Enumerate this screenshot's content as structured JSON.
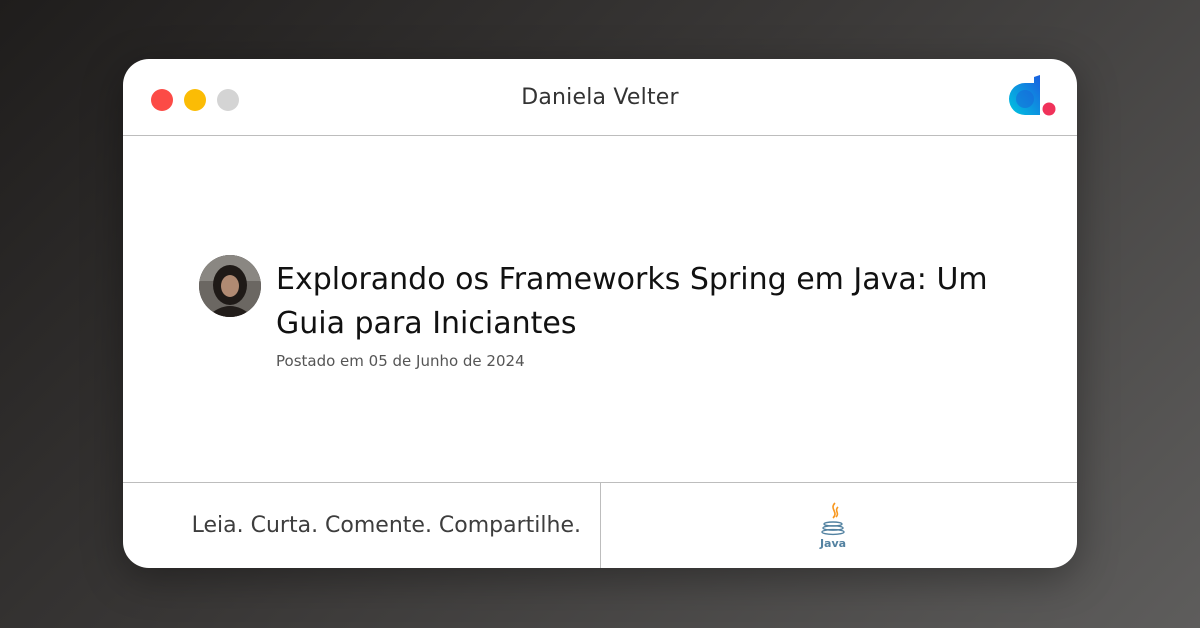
{
  "window": {
    "title": "Daniela Velter",
    "controls": [
      "close-dot",
      "minimize-dot",
      "maximize-dot"
    ]
  },
  "brand": {
    "logo_icon": "d-dot-logo-icon",
    "colors": {
      "primary_blue": "#1a73e8",
      "teal": "#00b8d4",
      "accent_red": "#f0325a"
    }
  },
  "post": {
    "title": "Explorando os Frameworks Spring em Java: Um Guia para Iniciantes",
    "date": "Postado em 05 de Junho de 2024",
    "avatar_icon": "author-avatar"
  },
  "footer": {
    "tagline": "Leia. Curta. Comente. Compartilhe.",
    "tech_logo": {
      "icon": "java-logo-icon",
      "label": "Java",
      "colors": {
        "cup": "#5382a1",
        "steam": "#f89820"
      }
    }
  },
  "colors": {
    "close": "#fc4b46",
    "minimize": "#fbbc05",
    "maximize": "#d4d4d4"
  }
}
